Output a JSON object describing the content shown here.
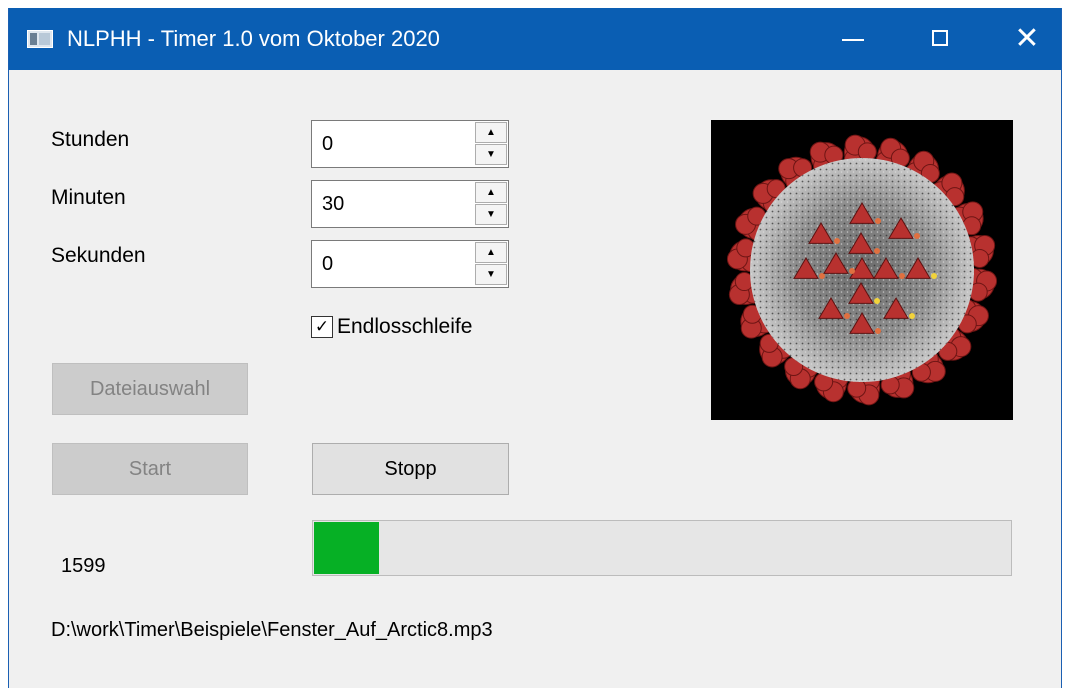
{
  "window": {
    "title": "NLPHH - Timer 1.0 vom Oktober 2020",
    "app_icon": "timer-app-icon",
    "controls": {
      "minimize": "minimize-icon",
      "maximize": "maximize-icon",
      "close": "close-icon",
      "close_glyph": "✕"
    },
    "colors": {
      "titlebar": "#0a5eb3",
      "background": "#f0f0f0",
      "progress": "#06b025"
    }
  },
  "form": {
    "fields": {
      "hours": {
        "label": "Stunden",
        "value": "0"
      },
      "minutes": {
        "label": "Minuten",
        "value": "30"
      },
      "seconds": {
        "label": "Sekunden",
        "value": "0"
      }
    },
    "spin_up_glyph": "▲",
    "spin_down_glyph": "▼",
    "loop": {
      "label": "Endlosschleife",
      "checked": true,
      "check_glyph": "✓"
    },
    "file_select_label": "Dateiauswahl",
    "start_label": "Start",
    "stop_label": "Stopp",
    "counter": "1599",
    "progress_fraction": 0.093,
    "file_path": "D:\\work\\Timer\\Beispiele\\Fenster_Auf_Arctic8.mp3"
  },
  "image": {
    "subject": "coronavirus-illustration",
    "background": "#000000",
    "spike_color": "#b8312f",
    "body_color": "#9a9a9a"
  }
}
